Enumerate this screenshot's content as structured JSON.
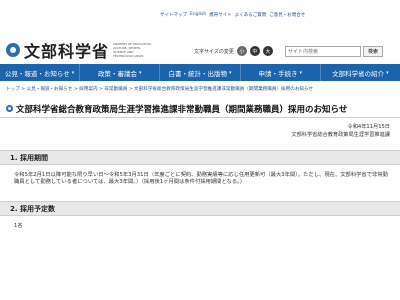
{
  "header": {
    "logo_text": "文部科学省",
    "logo_en": "MINISTRY OF EDUCATION, CULTURE, SPORTS, SCIENCE AND TECHNOLOGY-JAPAN",
    "util_links": [
      "サイトマップ",
      "English",
      "携帯サイト",
      "よくあるご質問",
      "ご意見・お問合せ"
    ],
    "fontsize_label": "文字サイズの変更",
    "fontsize_small": "小",
    "fontsize_medium": "中",
    "fontsize_large": "大",
    "search_placeholder": "サイト内検索",
    "search_button": "検索"
  },
  "nav": {
    "items": [
      {
        "label": "公見・報道・お知らせ"
      },
      {
        "label": "政策・審議会"
      },
      {
        "label": "白書・統計・出版物"
      },
      {
        "label": "申請・手続き"
      },
      {
        "label": "文部科学省の紹介"
      }
    ]
  },
  "breadcrumb": "トップ > 公見・報道・お知らせ > 採用案内 > 非常勤職員 > 文部科学省総合教育政策局生涯学習推進課非常勤職員（期間業務職員）採用のお知らせ",
  "page": {
    "title": "文部科学省総合教育政策局生涯学習推進課非常勤職員（期間業務職員）採用のお知らせ",
    "date": "令和4年11月15日",
    "org": "文部科学省総合教育政策局生涯学習推進課"
  },
  "sections": [
    {
      "heading": "1. 採用期間",
      "body": "令和5年2月1日以降可能な限り早い日～令和5年3月31日（年度ごとに契約、勤務実績等に応じ任用更新可（最大3年間）。ただし、現在、文部科学省で非常勤職員として勤務している者については、最大3年間。）（採用後1ヶ月間は条件付採用期間となる。）"
    },
    {
      "heading": "2. 採用予定数",
      "body": "1名"
    }
  ]
}
